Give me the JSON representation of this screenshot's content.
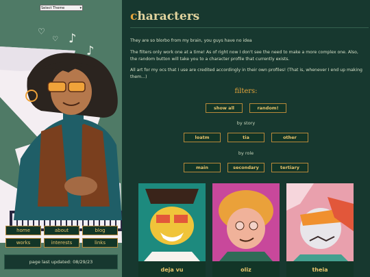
{
  "theme_select": {
    "selected": "Select Theme"
  },
  "nav": [
    {
      "label": "home"
    },
    {
      "label": "about"
    },
    {
      "label": "blog"
    },
    {
      "label": "works"
    },
    {
      "label": "interests"
    },
    {
      "label": "links"
    }
  ],
  "updated": "page last updated: 08/29/23",
  "page": {
    "title_first": "c",
    "title_rest": "haracters",
    "paragraphs": [
      "They are so blorbo from my brain, you guys have no idea",
      "The filters only work one at a time! As of right now I don't see the need to make a more complex one. Also, the random button will take you to a character profile that currently exists.",
      "All art for my ocs that I use are credited accordingly in their own profiles! (That is, whenever I end up making them...)"
    ]
  },
  "filters": {
    "label": "filters:",
    "general": [
      "show all",
      "random!"
    ],
    "by_story_label": "by story",
    "story": [
      "loatm",
      "tia",
      "other"
    ],
    "by_role_label": "by role",
    "role": [
      "main",
      "secondary",
      "tertiary"
    ]
  },
  "cards": [
    {
      "name": "deja vu",
      "bg": "#1d8a7e"
    },
    {
      "name": "oliz",
      "bg": "#c8489b"
    },
    {
      "name": "theia",
      "bg": "#e9a0ad"
    }
  ],
  "colors": {
    "accent": "#e7a63b",
    "bg": "#17382f",
    "sidebar": "#4f7a66"
  }
}
